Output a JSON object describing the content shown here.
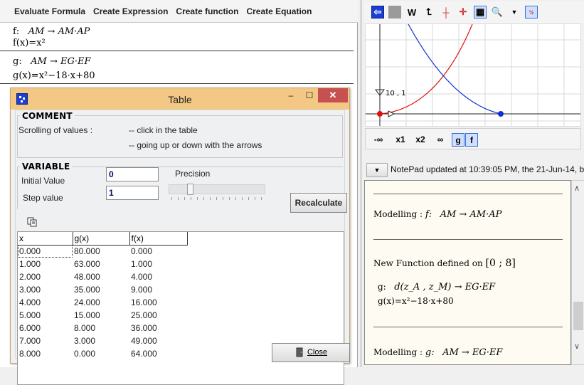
{
  "menu": {
    "items": [
      "Evaluate Formula",
      "Create Expression",
      "Create function",
      "Create Equation"
    ]
  },
  "definitions": {
    "f_line1_name": "f:",
    "f_line1_expr": "AM → AM·AP",
    "f_line2": "f(x)=x²",
    "g_line1_name": "g:",
    "g_line1_expr": "AM → EG·EF",
    "g_line2": "g(x)=x²−18·x+80"
  },
  "table_window": {
    "title": "Table",
    "minimize": "–",
    "maximize": "☐",
    "close": "✕",
    "comment": {
      "title": "COMMENT",
      "label": "Scrolling of values :",
      "hint1": "-- click in the table",
      "hint2": "-- going up or down with the arrows"
    },
    "variable": {
      "title": "VARIABLE",
      "initial_label": "Initial Value",
      "initial_value": "0",
      "step_label": "Step value",
      "step_value": "1",
      "precision_label": "Precision",
      "precision_level": 0.2,
      "recalculate": "Recalculate"
    },
    "grid": {
      "headers": [
        "x",
        "g(x)",
        "f(x)"
      ],
      "rows": [
        [
          "0.000",
          "80.000",
          "0.000"
        ],
        [
          "1.000",
          "63.000",
          "1.000"
        ],
        [
          "2.000",
          "48.000",
          "4.000"
        ],
        [
          "3.000",
          "35.000",
          "9.000"
        ],
        [
          "4.000",
          "24.000",
          "16.000"
        ],
        [
          "5.000",
          "15.000",
          "25.000"
        ],
        [
          "6.000",
          "8.000",
          "36.000"
        ],
        [
          "7.000",
          "3.000",
          "49.000"
        ],
        [
          "8.000",
          "0.000",
          "64.000"
        ]
      ]
    },
    "close_button": "Close"
  },
  "graph": {
    "toolbar_w": "W",
    "axis_label": "10 , 1",
    "colors": {
      "f_curve": "#e01010",
      "g_curve": "#1030d0",
      "point_red": "#e01010",
      "point_blue": "#1030d0"
    },
    "bottom_buttons": [
      "-∞",
      "x1",
      "x2",
      "∞",
      "g",
      "f"
    ]
  },
  "notepad": {
    "status": "NotePad updated at 10:39:05 PM, the 21-Jun-14, b",
    "modelling1_label": "Modelling :",
    "modelling1_name": "f:",
    "modelling1_expr": "AM → AM·AP",
    "newfunc_text": "New Function defined on",
    "newfunc_interval": "[0 ; 8]",
    "g_name": "g:",
    "g_def": "d(z_A , z_M) → EG·EF",
    "g_formula": "g(x)=x²−18·x+80",
    "modelling2_label": "Modelling :",
    "modelling2_name": "g:",
    "modelling2_expr": "AM → EG·EF"
  }
}
